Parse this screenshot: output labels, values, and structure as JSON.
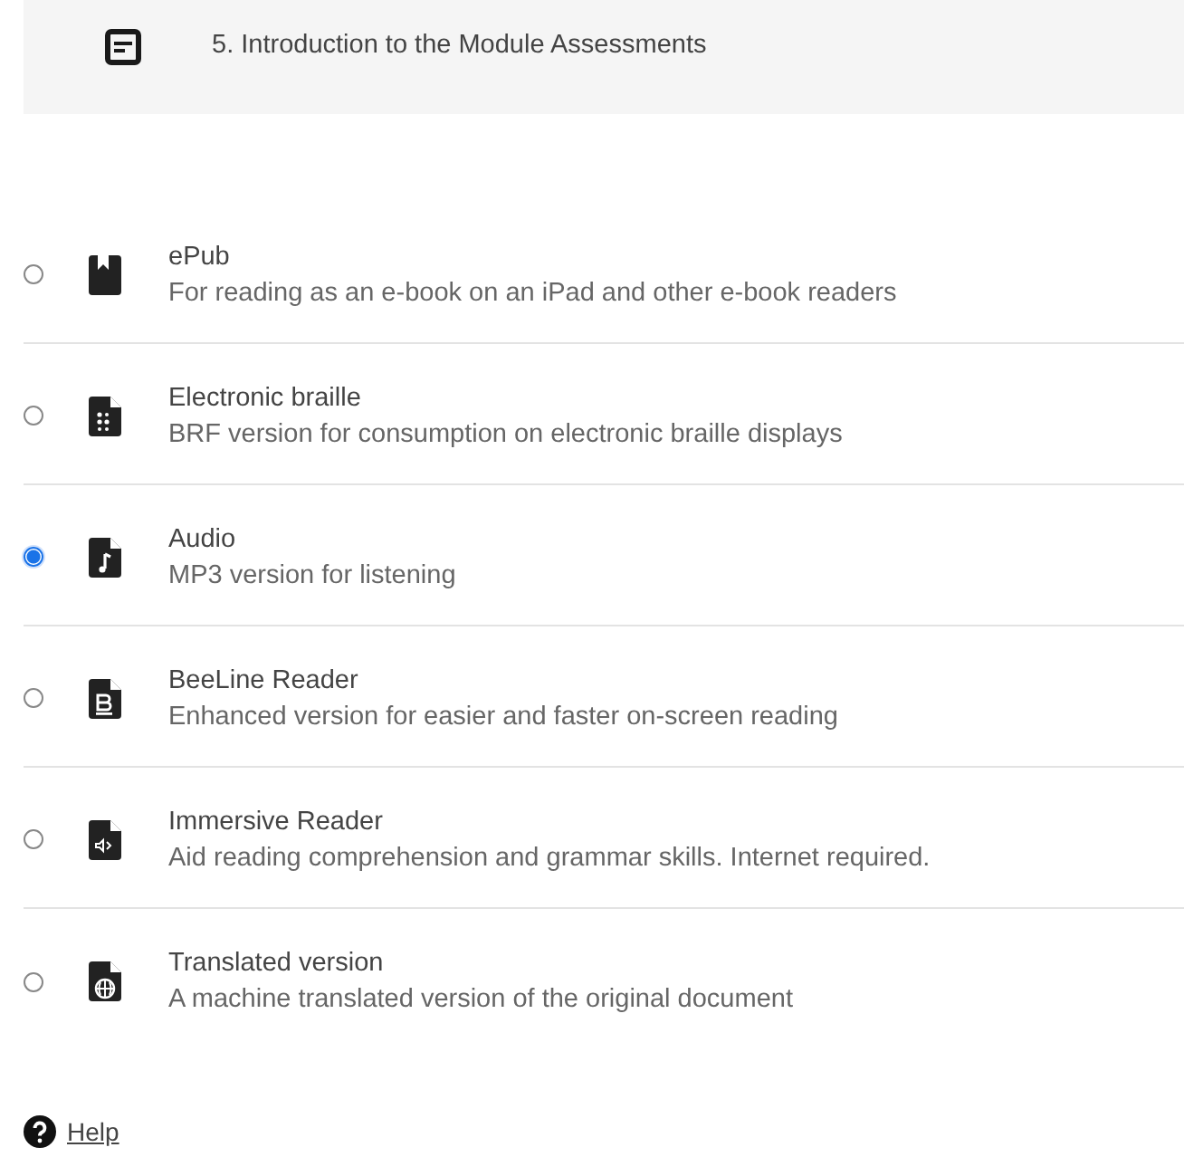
{
  "header": {
    "title": "5. Introduction to the Module Assessments"
  },
  "options": [
    {
      "kind": "epub",
      "title": "ePub",
      "description": "For reading as an e-book on an iPad and other e-book readers",
      "selected": false
    },
    {
      "kind": "braille",
      "title": "Electronic braille",
      "description": "BRF version for consumption on electronic braille displays",
      "selected": false
    },
    {
      "kind": "audio",
      "title": "Audio",
      "description": "MP3 version for listening",
      "selected": true
    },
    {
      "kind": "beeline",
      "title": "BeeLine Reader",
      "description": "Enhanced version for easier and faster on-screen reading",
      "selected": false
    },
    {
      "kind": "immersive",
      "title": "Immersive Reader",
      "description": "Aid reading comprehension and grammar skills. Internet required.",
      "selected": false
    },
    {
      "kind": "translated",
      "title": "Translated version",
      "description": "A machine translated version of the original document",
      "selected": false
    }
  ],
  "help": {
    "label": "Help"
  }
}
